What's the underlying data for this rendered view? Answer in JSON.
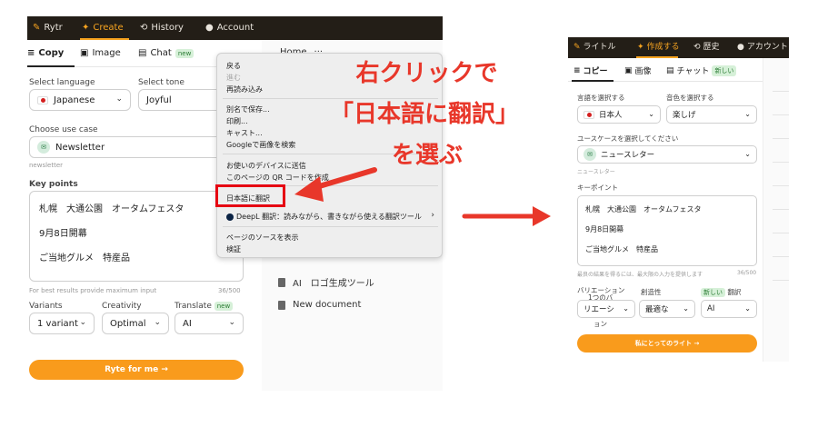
{
  "left": {
    "nav": {
      "logo": "Rytr",
      "create": "Create",
      "history": "History",
      "account": "Account"
    },
    "tabs": {
      "copy": "Copy",
      "image": "Image",
      "chat": "Chat",
      "chat_badge": "new"
    },
    "language_label": "Select language",
    "language_value": "Japanese",
    "tone_label": "Select tone",
    "tone_value": "Joyful",
    "usecase_label": "Choose use case",
    "usecase_value": "Newsletter",
    "usecase_hint": "newsletter",
    "keypoints_label": "Key points",
    "keypoints_value": "札幌　大通公園　オータムフェスタ\n9月8日開幕\nご当地グルメ　特産品",
    "keypoints_hint": "For best results provide maximum input",
    "keypoints_count": "36/500",
    "variants_label": "Variants",
    "variants_value": "1 variant",
    "creativity_label": "Creativity",
    "creativity_value": "Optimal",
    "translate_label": "Translate",
    "translate_badge": "new",
    "translate_value": "AI",
    "cta": "Ryte for me  →",
    "side": {
      "home": "Home",
      "home_more": "···",
      "logo_tool": "AI　ロゴ生成ツール",
      "new_doc": "New document"
    }
  },
  "menu": {
    "back": "戻る",
    "forward": "進む",
    "reload": "再読み込み",
    "save_as": "別名で保存...",
    "print": "印刷...",
    "cast": "キャスト...",
    "google_image": "Googleで画像を検索",
    "send_device": "お使いのデバイスに送信",
    "qr": "このページの QR コードを作成",
    "translate_ja": "日本語に翻訳",
    "deepl": "DeepL 翻訳：読みながら、書きながら使える翻訳ツール",
    "view_source": "ページのソースを表示",
    "inspect": "検証"
  },
  "annotation": {
    "line1": "右クリックで",
    "line2": "「日本語に翻訳」",
    "line3": "を選ぶ"
  },
  "right": {
    "nav": {
      "logo": "ライトル",
      "create": "作成する",
      "history": "歴史",
      "account": "アカウント"
    },
    "tabs": {
      "copy": "コピー",
      "image": "画像",
      "chat": "チャット",
      "chat_badge": "新しい"
    },
    "language_label": "言語を選択する",
    "language_value": "日本人",
    "tone_label": "音色を選択する",
    "tone_value": "楽しげ",
    "usecase_label": "ユースケースを選択してください",
    "usecase_value": "ニュースレター",
    "usecase_hint": "ニュースレター",
    "keypoints_label": "キーポイント",
    "keypoints_value": "札幌　大通公園　オータムフェスタ\n9月8日開幕\nご当地グルメ　特産品",
    "keypoints_hint": "最良の結果を得るには、最大限の入力を提供します",
    "keypoints_count": "36/500",
    "variants_label": "バリエーション",
    "variants_overlay": "1つのバ",
    "variants_value": "リエーシ",
    "variants_wrap": "ョン",
    "creativity_label": "創造性",
    "creativity_value": "最適な",
    "translate_badge": "新しい",
    "translate_label": "翻訳",
    "translate_value": "AI",
    "cta": "私にとってのライト →"
  }
}
